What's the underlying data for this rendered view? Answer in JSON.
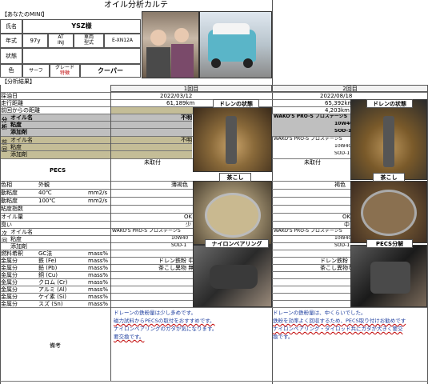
{
  "header": {
    "title": "オイル分析カルテ",
    "your_mini": "【あなたのMINI】"
  },
  "info": {
    "name_label": "氏名",
    "name_value": "YSZ様",
    "year_label": "年式",
    "year_value": "97y",
    "trans_top": "AT",
    "trans_bottom": "INJ",
    "repair_top": "車両",
    "repair_bottom": "型式",
    "model_code": "E-XN12A",
    "condition_label": "状態",
    "color_label": "色",
    "color_value": "サーフ",
    "grade_label_top": "グレード",
    "grade_label_bottom": "特徴",
    "grade_value": "クーパー"
  },
  "results": {
    "section_label": "【分析結果】",
    "round1": "1回目",
    "round2": "2回目",
    "date_label": "採油日",
    "date1": "2022/03/12",
    "date2": "2022/08/18",
    "mileage_label": "走行距離",
    "mileage1": "61,189km",
    "mileage2": "65,392km",
    "since_label": "前回からの距離",
    "since2": "4,203km",
    "side_bunseki": "分析",
    "side_zenkai": "前回",
    "side_jikai": "次回",
    "oil_name_label": "オイル名",
    "oil1": "不明",
    "oil2": "WAKO'S PRO-S プロステージS",
    "viscosity_label": "粘度",
    "visc2": "10W40",
    "additive_label": "添加剤",
    "add2": "SOD-1",
    "prev_oil_label": "オイル名",
    "prev_oil1": "不明",
    "prev_oil2": "WAKO'S PRO-S プロステージS",
    "prev_visc_label": "粘度",
    "prev_visc2": "10W40",
    "prev_add_label": "添加剤",
    "prev_add2": "SOD-1",
    "pecs_label": "PECS",
    "pecs1": "未取付",
    "pecs2": "未取付",
    "color_label": "色相",
    "color_mode": "外観",
    "color1": "薄褐色",
    "color2": "褐色",
    "visc40_label": "動粘度",
    "visc40_temp": "40℃",
    "visc40_unit": "mm2/s",
    "visc100_label": "動粘度",
    "visc100_temp": "100℃",
    "visc100_unit": "mm2/s",
    "vi_label": "粘度指数",
    "amount_label": "オイル量",
    "amount1": "OK",
    "amount2": "OK",
    "smell_label": "臭い",
    "smell1": "少",
    "smell2": "中",
    "next_oil_label": "オイル名",
    "next_oil1": "WAKO'S PRO-S プロステージS",
    "next_oil2": "WAKO'S PRO-S プロステージS",
    "next_visc_label": "粘度",
    "next_visc1": "10W40",
    "next_visc2": "10W40",
    "next_add_label": "添加剤",
    "next_add1": "SOD-1",
    "next_add2": "SOD-1",
    "fuel_label": "燃料希釈",
    "fuel_method": "GC法",
    "unit_mass": "mass%",
    "metals": [
      {
        "label": "金属分",
        "elem": "鉄 (Fe)",
        "v1": "ドレン鉄粉 中",
        "v2": "ドレン鉄粉 中"
      },
      {
        "label": "金属分",
        "elem": "鉛 (Pb)",
        "v1": "茶こし異物 無",
        "v2": "茶こし異物なし"
      },
      {
        "label": "金属分",
        "elem": "銅 (Cu)",
        "v1": "",
        "v2": ""
      },
      {
        "label": "金属分",
        "elem": "クロム (Cr)",
        "v1": "",
        "v2": ""
      },
      {
        "label": "金属分",
        "elem": "アルミ (Al)",
        "v1": "",
        "v2": ""
      },
      {
        "label": "金属分",
        "elem": "ケイ素 (Si)",
        "v1": "",
        "v2": ""
      },
      {
        "label": "金属分",
        "elem": "スズ (Sn)",
        "v1": "",
        "v2": ""
      }
    ],
    "remarks_label": "備考",
    "remarks1": [
      "ドレーンの鉄粉量は少し多めです。",
      "磁力試料からPECSの取付をおすすめです。",
      "",
      "ナイロンベアリングのガタが気になります。",
      "要交換です。"
    ],
    "remarks2": [
      "ドレーンの鉄粉量は、中くらいでした。",
      "鉄粉を効率よく回収するため、PECS取り付けお勧めです",
      "",
      "ナイロンベアリング・タイロッド共にガタが大きく要交",
      "換です。"
    ]
  },
  "captions": {
    "drain1": "ドレンの状態",
    "strainer1": "茶こし",
    "nylon1": "ナイロンベアリング",
    "drain2": "ドレンの状態",
    "strainer2": "茶こし",
    "pecs2": "PECS分解"
  }
}
